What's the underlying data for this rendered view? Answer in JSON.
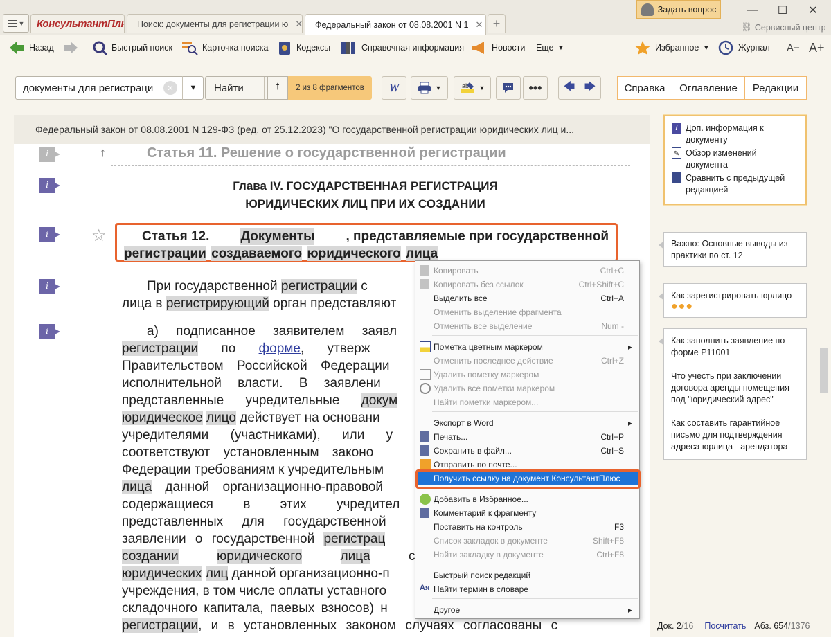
{
  "titlebar": {
    "logo": "КонсультантПлюс",
    "tabs": [
      "Поиск: документы для регистрации ю",
      "Федеральный закон от 08.08.2001 N 1"
    ],
    "ask_label": "Задать вопрос",
    "service_label": "Сервисный центр"
  },
  "toolbar": {
    "back": "Назад",
    "quick_search": "Быстрый поиск",
    "search_card": "Карточка поиска",
    "codexes": "Кодексы",
    "reference": "Справочная информация",
    "news": "Новости",
    "more": "Еще",
    "favorites": "Избранное",
    "journal": "Журнал",
    "font_minus": "A−",
    "font_plus": "A+"
  },
  "searchbar": {
    "query": "документы для регистраци",
    "find_label": "Найти",
    "found_text": "2 из 8 фрагментов",
    "tabs": [
      "Справка",
      "Оглавление",
      "Редакции"
    ]
  },
  "document": {
    "header": "Федеральный закон от 08.08.2001 N 129-ФЗ (ред. от 25.12.2023) \"О государственной регистрации юридических лиц и...",
    "prev_article": "Статья 11. Решение о государственной регистрации",
    "chapter_line1": "Глава IV. ГОСУДАРСТВЕННАЯ РЕГИСТРАЦИЯ",
    "chapter_line2": "ЮРИДИЧЕСКИХ ЛИЦ ПРИ ИХ СОЗДАНИИ",
    "article_w1": "Статья 12.",
    "article_w2": "Документы",
    "article_w3": ", представляемые при государственной",
    "article_w4": "регистрации",
    "article_w5": "создаваемого",
    "article_w6": "юридического",
    "article_w7": "лица",
    "p1": {
      "a": "При государственной ",
      "b": "регистрации",
      "c": " с",
      "d": "лица в ",
      "e": "регистрирующий",
      "f": " орган представляют"
    },
    "p2": {
      "l1": "а) подписанное заявителем заявл",
      "l2a": "регистрации",
      "l2b": " по ",
      "l2c": "форме",
      "l2d": ", утверж",
      "l3": "Правительством Российской Федерации",
      "l4": "исполнительной власти. В заявлени",
      "l5a": "представленные учредительные ",
      "l5b": "докум",
      "l6a": "юридическое",
      "l6b": "лицо",
      "l6c": " действует на основани",
      "l7": "учредителями (участниками), или у",
      "l8": "соответствуют установленным законо",
      "l9": "Федерации требованиям к учредительным",
      "l10a": "лица",
      "l10b": " данной организационно-правовой",
      "l11": "содержащиеся в этих учредител",
      "l12": "представленных для государственной",
      "l13a": "заявлении о государственной ",
      "l13b": "регистрац",
      "l14a": "создании",
      "l14b": "юридического",
      "l14c": "лица",
      "l14d": " соблю",
      "l15a": "юридических",
      "l15b": "лиц",
      "l15c": " данной организационно-п",
      "l16": "учреждения, в том числе оплаты уставного",
      "l17": "складочного капитала, паевых взносов) н",
      "l18a": "регистрации",
      "l18b": ", и в установленных законом случаях согласованы с"
    }
  },
  "right_panel": {
    "info": [
      "Доп. информация к документу",
      "Обзор изменений документа",
      "Сравнить с предыдущей редакцией"
    ],
    "note1": "Важно: Основные выводы из практики по ст. 12",
    "note2": "Как зарегистрировать юрлицо",
    "note3": [
      "Как заполнить заявление по форме Р11001",
      "Что учесть при заключении договора аренды помещения под \"юридический адрес\"",
      "Как составить гарантийное письмо для подтверждения адреса юрлица - арендатора"
    ]
  },
  "status": {
    "doc_label": "Док. 2",
    "doc_total": "/16",
    "count_label": "Посчитать",
    "abs_label": "Абз. 654",
    "abs_total": "/1376"
  },
  "context_menu": [
    {
      "label": "Копировать",
      "shortcut": "Ctrl+C",
      "disabled": true
    },
    {
      "label": "Копировать без ссылок",
      "shortcut": "Ctrl+Shift+C",
      "disabled": true
    },
    {
      "label": "Выделить все",
      "shortcut": "Ctrl+A",
      "disabled": false
    },
    {
      "label": "Отменить выделение фрагмента",
      "shortcut": "",
      "disabled": true
    },
    {
      "label": "Отменить все выделение",
      "shortcut": "Num -",
      "disabled": true
    },
    {
      "label": "Пометка цветным маркером",
      "shortcut": "",
      "disabled": false
    },
    {
      "label": "Отменить последнее действие",
      "shortcut": "Ctrl+Z",
      "disabled": true
    },
    {
      "label": "Удалить пометку маркером",
      "shortcut": "",
      "disabled": true
    },
    {
      "label": "Удалить все пометки маркером",
      "shortcut": "",
      "disabled": true
    },
    {
      "label": "Найти пометки маркером...",
      "shortcut": "",
      "disabled": true
    },
    {
      "label": "Экспорт в Word",
      "shortcut": "",
      "disabled": false
    },
    {
      "label": "Печать...",
      "shortcut": "Ctrl+P",
      "disabled": false
    },
    {
      "label": "Сохранить в файл...",
      "shortcut": "Ctrl+S",
      "disabled": false
    },
    {
      "label": "Отправить по почте...",
      "shortcut": "",
      "disabled": false
    },
    {
      "label": "Получить ссылку на документ КонсультантПлюс",
      "shortcut": "",
      "disabled": false
    },
    {
      "label": "Добавить в Избранное...",
      "shortcut": "",
      "disabled": false
    },
    {
      "label": "Комментарий к фрагменту",
      "shortcut": "",
      "disabled": false
    },
    {
      "label": "Поставить на контроль",
      "shortcut": "F3",
      "disabled": false
    },
    {
      "label": "Список закладок в документе",
      "shortcut": "Shift+F8",
      "disabled": true
    },
    {
      "label": "Найти закладку в документе",
      "shortcut": "Ctrl+F8",
      "disabled": true
    },
    {
      "label": "Быстрый поиск редакций",
      "shortcut": "",
      "disabled": false
    },
    {
      "label": "Найти термин в словаре",
      "shortcut": "",
      "disabled": false
    },
    {
      "label": "Другое",
      "shortcut": "",
      "disabled": false
    }
  ],
  "colors": {
    "accent_orange": "#e8632e",
    "highlight_blue": "#1f73d6",
    "marker_purple": "#6c65a8"
  }
}
